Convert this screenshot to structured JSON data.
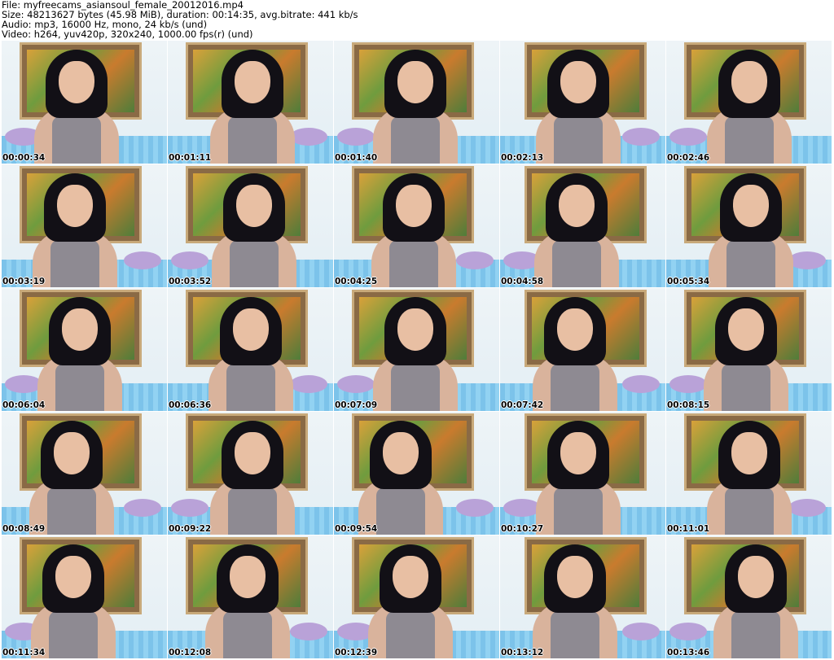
{
  "header": {
    "file_line": "File: myfreecams_asiansoul_female_20012016.mp4",
    "size_line": "Size: 48213627 bytes (45.98 MiB), duration: 00:14:35, avg.bitrate: 441 kb/s",
    "audio_line": "Audio: mp3, 16000 Hz, mono, 24 kb/s (und)",
    "video_line": "Video: h264, yuv420p, 320x240, 1000.00 fps(r) (und)"
  },
  "thumbnails": [
    {
      "timestamp": "00:00:34"
    },
    {
      "timestamp": "00:01:11"
    },
    {
      "timestamp": "00:01:40"
    },
    {
      "timestamp": "00:02:13"
    },
    {
      "timestamp": "00:02:46"
    },
    {
      "timestamp": "00:03:19"
    },
    {
      "timestamp": "00:03:52"
    },
    {
      "timestamp": "00:04:25"
    },
    {
      "timestamp": "00:04:58"
    },
    {
      "timestamp": "00:05:34"
    },
    {
      "timestamp": "00:06:04"
    },
    {
      "timestamp": "00:06:36"
    },
    {
      "timestamp": "00:07:09"
    },
    {
      "timestamp": "00:07:42"
    },
    {
      "timestamp": "00:08:15"
    },
    {
      "timestamp": "00:08:49"
    },
    {
      "timestamp": "00:09:22"
    },
    {
      "timestamp": "00:09:54"
    },
    {
      "timestamp": "00:10:27"
    },
    {
      "timestamp": "00:11:01"
    },
    {
      "timestamp": "00:11:34"
    },
    {
      "timestamp": "00:12:08"
    },
    {
      "timestamp": "00:12:39"
    },
    {
      "timestamp": "00:13:12"
    },
    {
      "timestamp": "00:13:46"
    }
  ]
}
